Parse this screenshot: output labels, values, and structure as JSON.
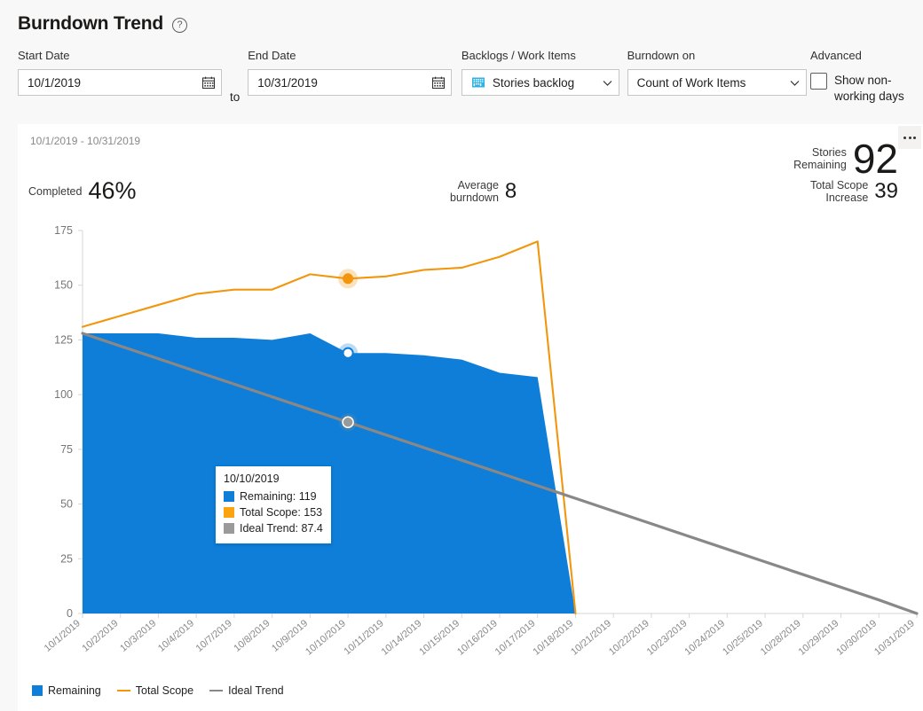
{
  "header": {
    "title": "Burndown Trend",
    "help_icon": "help-circle-icon"
  },
  "toolbar": {
    "start_date": {
      "label": "Start Date",
      "value": "10/1/2019",
      "icon": "calendar-icon"
    },
    "separator": "to",
    "end_date": {
      "label": "End Date",
      "value": "10/31/2019",
      "icon": "calendar-icon"
    },
    "backlog": {
      "label": "Backlogs / Work Items",
      "value": "Stories backlog",
      "icon": "backlog-grid-icon",
      "chevron": "chevron-down-icon"
    },
    "burndown_on": {
      "label": "Burndown on",
      "value": "Count of Work Items",
      "chevron": "chevron-down-icon"
    },
    "advanced": {
      "label": "Advanced",
      "checkbox_label": "Show non-working days",
      "checked": false
    }
  },
  "card": {
    "date_range": "10/1/2019 - 10/31/2019",
    "overflow_menu": "more-options-icon",
    "stats": {
      "remaining": {
        "label": "Stories\nRemaining",
        "value": "92"
      },
      "completed": {
        "label": "Completed",
        "value": "46%"
      },
      "average": {
        "label": "Average\nburndown",
        "value": "8"
      },
      "scope_increase": {
        "label": "Total Scope\nIncrease",
        "value": "39"
      }
    }
  },
  "tooltip": {
    "date": "10/10/2019",
    "rows": [
      {
        "label": "Remaining: 119",
        "color": "#0f7ed8"
      },
      {
        "label": "Total Scope: 153",
        "color": "#fca311"
      },
      {
        "label": "Ideal Trend: 87.4",
        "color": "#9a9a9a"
      }
    ]
  },
  "legend": [
    {
      "label": "Remaining",
      "marker": "square",
      "color": "#0f7ed8"
    },
    {
      "label": "Total Scope",
      "marker": "line",
      "color": "#f2960d"
    },
    {
      "label": "Ideal Trend",
      "marker": "line",
      "color": "#8a8886"
    }
  ],
  "colors": {
    "remaining": "#0f7ed8",
    "total_scope": "#f2960d",
    "ideal_trend": "#8a8886",
    "accent": "#0078d7",
    "page_bg": "#f8f8f8",
    "card_bg": "#ffffff"
  },
  "chart_data": {
    "type": "area",
    "title": "Burndown Trend",
    "xlabel": "",
    "ylabel": "",
    "ylim": [
      0,
      175
    ],
    "yticks": [
      0,
      25,
      50,
      75,
      100,
      125,
      150,
      175
    ],
    "grid": false,
    "legend_position": "bottom-left",
    "categories": [
      "10/1/2019",
      "10/2/2019",
      "10/3/2019",
      "10/4/2019",
      "10/7/2019",
      "10/8/2019",
      "10/9/2019",
      "10/10/2019",
      "10/11/2019",
      "10/14/2019",
      "10/15/2019",
      "10/16/2019",
      "10/17/2019",
      "10/18/2019",
      "10/21/2019",
      "10/22/2019",
      "10/23/2019",
      "10/24/2019",
      "10/25/2019",
      "10/28/2019",
      "10/29/2019",
      "10/30/2019",
      "10/31/2019"
    ],
    "series": [
      {
        "name": "Remaining",
        "type": "area",
        "color": "#0f7ed8",
        "values": [
          128,
          128,
          128,
          126,
          126,
          125,
          128,
          119,
          119,
          118,
          116,
          110,
          108,
          0,
          null,
          null,
          null,
          null,
          null,
          null,
          null,
          null,
          null
        ]
      },
      {
        "name": "Total Scope",
        "type": "line",
        "color": "#f2960d",
        "values": [
          131,
          136,
          141,
          146,
          148,
          148,
          155,
          153,
          154,
          157,
          158,
          163,
          170,
          0,
          null,
          null,
          null,
          null,
          null,
          null,
          null,
          null,
          null
        ]
      },
      {
        "name": "Ideal Trend",
        "type": "line",
        "color": "#8a8886",
        "values": [
          128,
          122.2,
          116.4,
          110.6,
          104.8,
          99,
          93.2,
          87.4,
          81.6,
          75.8,
          70,
          64.2,
          58.4,
          52.6,
          46.8,
          41,
          35.2,
          29.4,
          23.6,
          17.8,
          12,
          6.2,
          0
        ]
      }
    ],
    "highlight": {
      "category": "10/10/2019",
      "points": [
        {
          "series": "Total Scope",
          "value": 153
        },
        {
          "series": "Remaining",
          "value": 119
        },
        {
          "series": "Ideal Trend",
          "value": 87.4
        }
      ]
    }
  }
}
